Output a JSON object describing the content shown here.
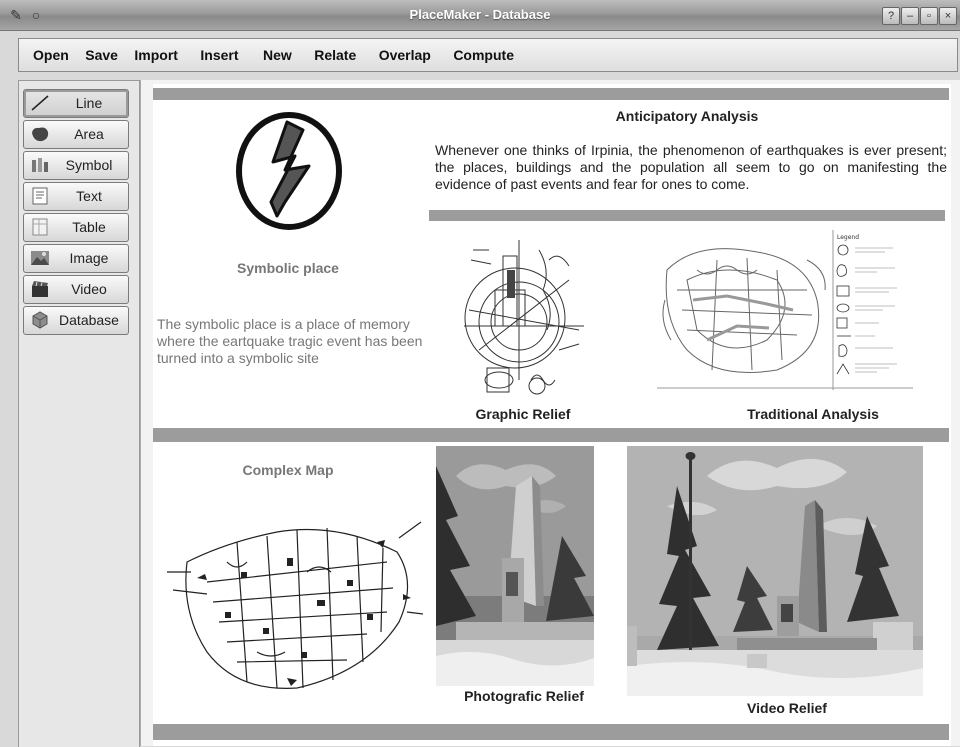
{
  "window": {
    "title": "PlaceMaker - Database",
    "buttons": [
      "?",
      "–",
      "▫",
      "×"
    ]
  },
  "menu": [
    "Open",
    "Save",
    "Import",
    "Insert",
    "New",
    "Relate",
    "Overlap",
    "Compute"
  ],
  "tools": [
    {
      "label": "Line",
      "icon": "line-icon",
      "active": true
    },
    {
      "label": "Area",
      "icon": "area-icon"
    },
    {
      "label": "Symbol",
      "icon": "symbol-icon"
    },
    {
      "label": "Text",
      "icon": "text-icon"
    },
    {
      "label": "Table",
      "icon": "table-icon"
    },
    {
      "label": "Image",
      "icon": "image-icon"
    },
    {
      "label": "Video",
      "icon": "video-icon"
    },
    {
      "label": "Database",
      "icon": "database-icon"
    }
  ],
  "content": {
    "anticipatory": {
      "title": "Anticipatory Analysis",
      "text": "Whenever one thinks of Irpinia, the phenomenon of earthquakes is ever present; the places, buildings and the population all seem to go on manifesting the evidence of past events and fear for ones to come."
    },
    "symbolic": {
      "title": "Symbolic place",
      "text": "The symbolic place is a place of memory where the eartquake tragic event has been turned into a symbolic site"
    },
    "captions": {
      "graphic_relief": "Graphic Relief",
      "traditional_analysis": "Traditional Analysis",
      "complex_map": "Complex Map",
      "photografic_relief": "Photografic Relief",
      "video_relief": "Video Relief"
    },
    "legend": {
      "title": "Legend"
    }
  }
}
